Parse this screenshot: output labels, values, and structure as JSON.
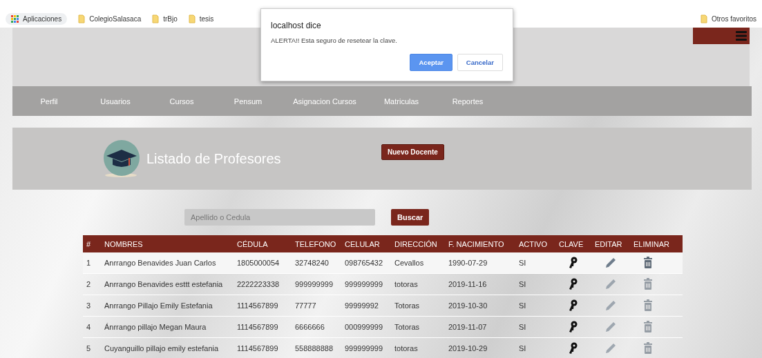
{
  "bookmarks": {
    "apps": "Aplicaciones",
    "folders": [
      "ColegioSalasaca",
      "trBjo",
      "tesis"
    ],
    "other": "Otros favoritos"
  },
  "dialog": {
    "title": "localhost dice",
    "message": "ALERTA!! Esta seguro de resetear la clave.",
    "buttons": [
      {
        "label": "Aceptar",
        "kind": "primary"
      },
      {
        "label": "Cancelar",
        "kind": "secondary"
      }
    ]
  },
  "nav": [
    "Perfil",
    "Usuarios",
    "Cursos",
    "Pensum",
    "Asignacion Cursos",
    "Matriculas",
    "Reportes"
  ],
  "page": {
    "title": "Listado de Profesores",
    "new_button": "Nuevo Docente"
  },
  "search": {
    "placeholder": "Apellido o Cedula",
    "button": "Buscar"
  },
  "table": {
    "columns": [
      "#",
      "NOMBRES",
      "CÉDULA",
      "TELEFONO",
      "CELULAR",
      "DIRECCIÓN",
      "F. NACIMIENTO",
      "ACTIVO",
      "CLAVE",
      "EDITAR",
      "ELIMINAR"
    ],
    "rows": [
      {
        "cells": [
          "1",
          "Anrrango Benavides Juan Carlos",
          "1805000054",
          "32748240",
          "098765432",
          "Cevallos",
          "1990-07-29",
          "SI"
        ],
        "highlighted": true
      },
      {
        "cells": [
          "2",
          "Anrrango Benavides esttt estefania",
          "2222223338",
          "999999999",
          "999999999",
          "totoras",
          "2019-11-16",
          "SI"
        ],
        "highlighted": false
      },
      {
        "cells": [
          "3",
          "Anrrango Pillajo Emily Estefania",
          "1114567899",
          "77777",
          "99999992",
          "Totoras",
          "2019-10-30",
          "SI"
        ],
        "highlighted": false
      },
      {
        "cells": [
          "4",
          "Ánrrango pillajo Megan Maura",
          "1114567899",
          "6666666",
          "000999999",
          "Totoras",
          "2019-11-07",
          "SI"
        ],
        "highlighted": false
      },
      {
        "cells": [
          "5",
          "Cuyanguillo pillajo emily estefania",
          "1114567899",
          "558888888",
          "999999999",
          "totoras",
          "2019-10-29",
          "SI"
        ],
        "highlighted": false
      }
    ]
  }
}
